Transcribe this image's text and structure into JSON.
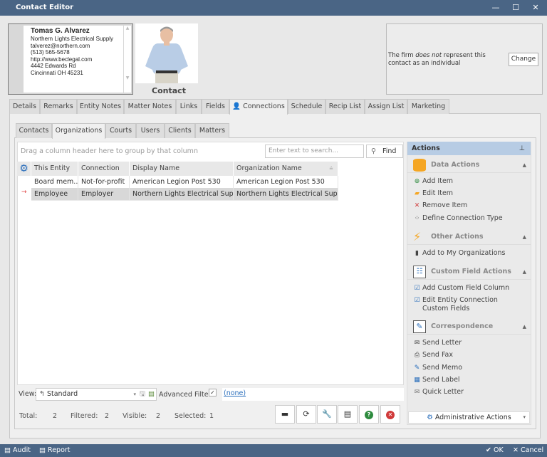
{
  "window": {
    "title": "Contact Editor",
    "minimize": "—",
    "maximize": "☐",
    "close": "✕"
  },
  "card": {
    "name": "Tomas G. Alvarez",
    "lines": [
      "Northern Lights Electrical Supply",
      "talverez@northern.com",
      "(513) 565-5678",
      "http://www.beclegal.com",
      "4442 Edwards Rd",
      "Cincinnati OH 45231"
    ]
  },
  "photo_label": "Contact",
  "firm": {
    "pre": "The firm ",
    "em": "does not",
    "post": " represent this contact as an individual",
    "change": "Change"
  },
  "tabs": [
    "Details",
    "Remarks",
    "Entity Notes",
    "Matter Notes",
    "Links",
    "Fields",
    "Connections",
    "Schedule",
    "Recip List",
    "Assign List",
    "Marketing"
  ],
  "subtabs": [
    "Contacts",
    "Organizations",
    "Courts",
    "Users",
    "Clients",
    "Matters"
  ],
  "grid": {
    "group_hint": "Drag a column header here to group by that column",
    "search_placeholder": "Enter text to search...",
    "find": "Find",
    "columns": [
      "This Entity",
      "Connection",
      "Display Name",
      "Organization Name"
    ],
    "rows": [
      [
        "Board mem...",
        "Not-for-profit",
        "American Legion Post 530",
        "American Legion Post 530"
      ],
      [
        "Employee",
        "Employer",
        "Northern Lights Electrical Supply",
        "Northern Lights Electrical Supply"
      ]
    ]
  },
  "view": {
    "label": "View:",
    "value": "Standard",
    "adv_label": "Advanced Filter:",
    "filter": "(none)"
  },
  "status": {
    "total_label": "Total:",
    "total": "2",
    "filtered_label": "Filtered:",
    "filtered": "2",
    "visible_label": "Visible:",
    "visible": "2",
    "selected_label": "Selected:",
    "selected": "1"
  },
  "actions": {
    "title": "Actions",
    "pin": "⊥",
    "sections": [
      {
        "title": "Data Actions",
        "items": [
          "Add Item",
          "Edit Item",
          "Remove Item",
          "Define Connection Type"
        ]
      },
      {
        "title": "Other Actions",
        "items": [
          "Add to My Organizations"
        ]
      },
      {
        "title": "Custom Field Actions",
        "items": [
          "Add Custom Field Column",
          "Edit Entity Connection Custom Fields"
        ]
      },
      {
        "title": "Correspondence",
        "items": [
          "Send Letter",
          "Send Fax",
          "Send Memo",
          "Send Label",
          "Quick Letter"
        ]
      }
    ],
    "admin": "Administrative Actions"
  },
  "footer": {
    "audit": "Audit",
    "report": "Report",
    "ok": "OK",
    "cancel": "Cancel"
  },
  "colors": {
    "titlebar": "#4a6585",
    "accent": "#2a6ebb"
  }
}
